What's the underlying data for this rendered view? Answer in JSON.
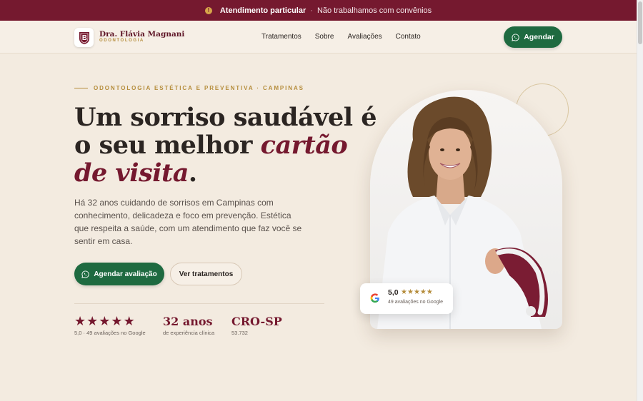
{
  "colors": {
    "burgundy": "#75192f",
    "green": "#1e6a40",
    "gold": "#b58d3c",
    "background": "#f3ebe0"
  },
  "topbar": {
    "icon": "info-icon",
    "strong": "Atendimento particular",
    "separator": "·",
    "text": "Não trabalhamos com convênios"
  },
  "brand": {
    "name": "Dra. Flávia Magnani",
    "subtitle": "ODONTOLOGIA"
  },
  "nav": {
    "links": [
      "Tratamentos",
      "Sobre",
      "Avaliações",
      "Contato"
    ],
    "cta": "Agendar",
    "cta_icon": "whatsapp-icon"
  },
  "hero": {
    "eyebrow": "ODONTOLOGIA ESTÉTICA E PREVENTIVA · CAMPINAS",
    "headline": {
      "line1": "Um sorriso saudável é",
      "line2_plain": "o seu melhor ",
      "line2_accent": "cartão",
      "line3_accent": "de visita",
      "line3_end": "."
    },
    "description": "Há 32 anos cuidando de sorrisos em Campinas com conhecimento, delicadeza e foco em prevenção. Estética que respeita a saúde, com um atendimento que faz você se sentir em casa.",
    "primary_cta": "Agendar avaliação",
    "secondary_cta": "Ver tratamentos"
  },
  "stats": {
    "rating": {
      "stars": 5,
      "label": "5,0 · 49 avaliações no Google"
    },
    "experience": {
      "value": "32 anos",
      "label": "de experiência clínica"
    },
    "cro": {
      "value": "CRO-SP",
      "label": "53.732"
    }
  },
  "rating_card": {
    "score": "5,0",
    "stars": 5,
    "count": "49 avaliações no Google",
    "icon": "google-icon"
  }
}
